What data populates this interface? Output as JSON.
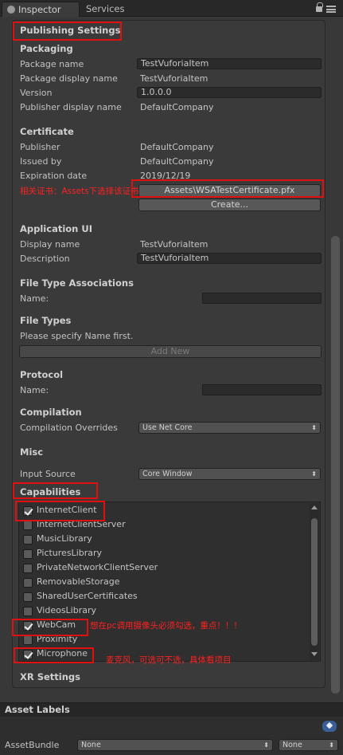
{
  "tabs": {
    "inspector": "Inspector",
    "services": "Services"
  },
  "publishing": {
    "title": "Publishing Settings",
    "packaging": {
      "heading": "Packaging",
      "package_name_label": "Package name",
      "package_name_value": "TestVuforiaItem",
      "display_name_label": "Package display name",
      "display_name_value": "TestVuforiaItem",
      "version_label": "Version",
      "version_value": "1.0.0.0",
      "publisher_display_label": "Publisher display name",
      "publisher_display_value": "DefaultCompany"
    },
    "certificate": {
      "heading": "Certificate",
      "publisher_label": "Publisher",
      "publisher_value": "DefaultCompany",
      "issued_label": "Issued by",
      "issued_value": "DefaultCompany",
      "expiration_label": "Expiration date",
      "expiration_value": "2019/12/19",
      "file_button": "Assets\\WSATestCertificate.pfx",
      "create_button": "Create..."
    },
    "app_ui": {
      "heading": "Application UI",
      "display_label": "Display name",
      "display_value": "TestVuforiaItem",
      "description_label": "Description",
      "description_value": "TestVuforiaItem"
    },
    "file_type_assoc": {
      "heading": "File Type Associations",
      "name_label": "Name:",
      "name_value": ""
    },
    "file_types": {
      "heading": "File Types",
      "hint": "Please specify Name first.",
      "add_button": "Add New"
    },
    "protocol": {
      "heading": "Protocol",
      "name_label": "Name:",
      "name_value": ""
    },
    "compilation": {
      "heading": "Compilation",
      "overrides_label": "Compilation Overrides",
      "overrides_value": "Use Net Core"
    },
    "misc": {
      "heading": "Misc",
      "input_label": "Input Source",
      "input_value": "Core Window"
    },
    "capabilities": {
      "heading": "Capabilities",
      "items": [
        {
          "label": "InternetClient",
          "checked": true
        },
        {
          "label": "InternetClientServer",
          "checked": false
        },
        {
          "label": "MusicLibrary",
          "checked": false
        },
        {
          "label": "PicturesLibrary",
          "checked": false
        },
        {
          "label": "PrivateNetworkClientServer",
          "checked": false
        },
        {
          "label": "RemovableStorage",
          "checked": false
        },
        {
          "label": "SharedUserCertificates",
          "checked": false
        },
        {
          "label": "VideosLibrary",
          "checked": false
        },
        {
          "label": "WebCam",
          "checked": true
        },
        {
          "label": "Proximity",
          "checked": false
        },
        {
          "label": "Microphone",
          "checked": true
        }
      ]
    }
  },
  "xr_settings": "XR Settings",
  "asset_labels": {
    "title": "Asset Labels",
    "bundle_label": "AssetBundle",
    "bundle_value": "None",
    "variant_value": "None"
  },
  "annotations": {
    "certificate_note": "相关证书：Assets下选择该证书",
    "webcam_note": "想在pc调用摄像头必须勾选，重点！！！",
    "microphone_note": "麦克风，可选可不选，具体看项目"
  },
  "colors": {
    "annotation_red": "#e01010",
    "panel_bg": "#383838"
  }
}
